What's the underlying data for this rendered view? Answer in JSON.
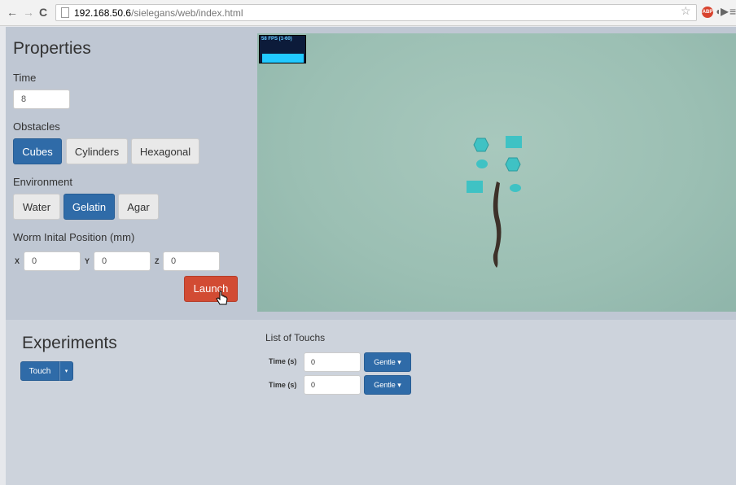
{
  "browser": {
    "url_host": "192.168.50.6",
    "url_path": "/sielegans/web/index.html",
    "abp_label": "ABP"
  },
  "properties": {
    "title": "Properties",
    "time_label": "Time",
    "time_value": "8",
    "obstacles_label": "Obstacles",
    "obstacles": [
      "Cubes",
      "Cylinders",
      "Hexagonal"
    ],
    "obstacles_selected": "Cubes",
    "environment_label": "Environment",
    "environments": [
      "Water",
      "Gelatin",
      "Agar"
    ],
    "environment_selected": "Gelatin",
    "position_label": "Worm Inital Position (mm)",
    "x_label": "X",
    "x_value": "0",
    "y_label": "Y",
    "y_value": "0",
    "z_label": "Z",
    "z_value": "0",
    "launch_label": "Launch"
  },
  "viewport": {
    "fps_text": "58 FPS (1-60)"
  },
  "experiments": {
    "title": "Experiments",
    "touch_label": "Touch",
    "caret": "▾",
    "list_title": "List of Touchs",
    "touches": [
      {
        "time_label": "Time (s)",
        "time_value": "0",
        "type_label": "Gentle ▾"
      },
      {
        "time_label": "Time (s)",
        "time_value": "0",
        "type_label": "Gentle ▾"
      }
    ]
  },
  "colors": {
    "primary": "#2f6ba8",
    "danger": "#d24b33",
    "obstacle": "#3fc2c4",
    "scene": "#9bbfb3"
  }
}
